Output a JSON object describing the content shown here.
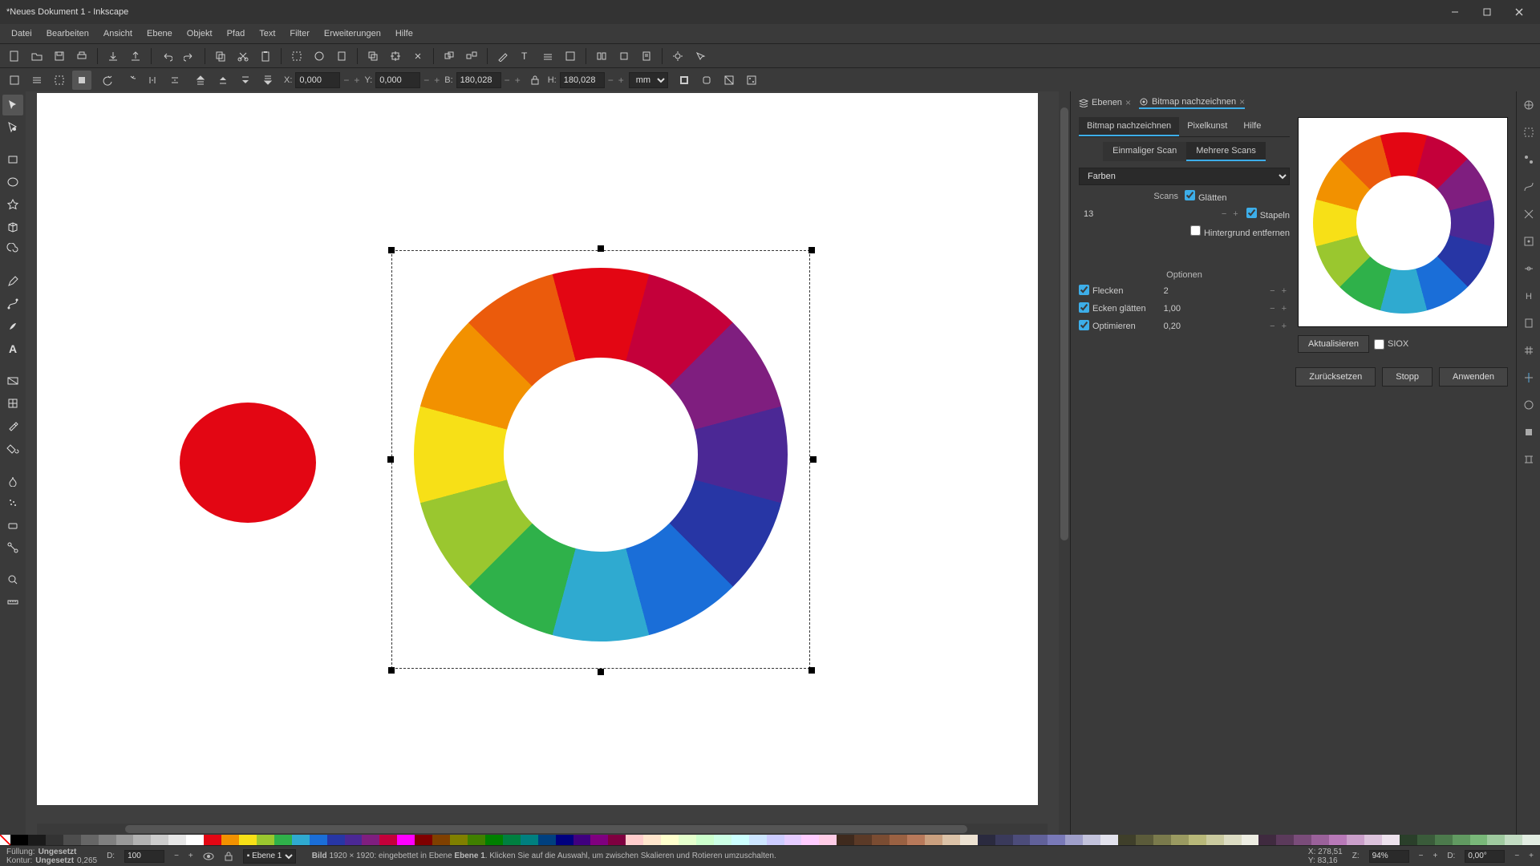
{
  "titlebar": {
    "title": "*Neues Dokument 1 - Inkscape"
  },
  "menu": {
    "items": [
      "Datei",
      "Bearbeiten",
      "Ansicht",
      "Ebene",
      "Objekt",
      "Pfad",
      "Text",
      "Filter",
      "Erweiterungen",
      "Hilfe"
    ]
  },
  "toolcontrol": {
    "x_label": "X:",
    "x": "0,000",
    "y_label": "Y:",
    "y": "0,000",
    "w_label": "B:",
    "w": "180,028",
    "h_label": "H:",
    "h": "180,028",
    "unit": "mm"
  },
  "dock": {
    "tab_layers": "Ebenen",
    "tab_trace": "Bitmap nachzeichnen",
    "trace_tabs": {
      "trace": "Bitmap nachzeichnen",
      "pixel": "Pixelkunst",
      "help": "Hilfe"
    },
    "sub_tabs": {
      "single": "Einmaliger Scan",
      "multi": "Mehrere Scans"
    },
    "mode": "Farben",
    "scans_label": "Scans",
    "scans": "13",
    "smooth": "Glätten",
    "stack": "Stapeln",
    "removebg": "Hintergrund entfernen",
    "options_header": "Optionen",
    "speckles": "Flecken",
    "speckles_val": "2",
    "corners": "Ecken glätten",
    "corners_val": "1,00",
    "optimize": "Optimieren",
    "optimize_val": "0,20",
    "update": "Aktualisieren",
    "siox": "SIOX",
    "reset": "Zurücksetzen",
    "stop": "Stopp",
    "apply": "Anwenden"
  },
  "status": {
    "fill_label": "Füllung:",
    "fill_val": "Ungesetzt",
    "stroke_label": "Kontur:",
    "stroke_val": "Ungesetzt",
    "stroke_w": "0,265",
    "opacity_label": "D:",
    "opacity": "100",
    "layer": "Ebene 1",
    "obj_type": "Bild",
    "obj_dims": "1920 × 1920:",
    "obj_msg": "eingebettet in Ebene",
    "obj_layer_bold": "Ebene 1",
    "obj_hint": ". Klicken Sie auf die Auswahl, um zwischen Skalieren und Rotieren umzuschalten.",
    "cx_label": "X:",
    "cx": "278,51",
    "cy_label": "Y:",
    "cy": "83,16",
    "zoom_label": "Z:",
    "zoom": "94%",
    "rot_label": "D:",
    "rot": "0,00°"
  },
  "palette_colors": [
    "#000000",
    "#1a1a1a",
    "#333333",
    "#4d4d4d",
    "#666666",
    "#808080",
    "#999999",
    "#b3b3b3",
    "#cccccc",
    "#e6e6e6",
    "#ffffff",
    "#e30613",
    "#f29100",
    "#f7e017",
    "#9ac72f",
    "#2fb14a",
    "#2faad0",
    "#1a6ed8",
    "#2736a5",
    "#4b2895",
    "#7f1e7f",
    "#c4003a",
    "#ff00ff",
    "#800000",
    "#804000",
    "#808000",
    "#408000",
    "#008000",
    "#008040",
    "#008080",
    "#004080",
    "#000080",
    "#400080",
    "#800080",
    "#800040",
    "#ffcccc",
    "#ffe5cc",
    "#ffffcc",
    "#e5ffcc",
    "#ccffcc",
    "#ccffe5",
    "#ccffff",
    "#cce5ff",
    "#ccccff",
    "#e5ccff",
    "#ffccff",
    "#ffcce6",
    "#3f2a1d",
    "#5b3a27",
    "#7a4c32",
    "#9a6142",
    "#b8795a",
    "#caa07f",
    "#dcc3a8",
    "#ede2d2",
    "#2a2a3f",
    "#3a3a5b",
    "#4c4c7a",
    "#61619a",
    "#7979b8",
    "#9f9fca",
    "#c3c3dc",
    "#e2e2ed",
    "#3f3f2a",
    "#5b5b3a",
    "#7a7a4c",
    "#9a9a61",
    "#b8b879",
    "#caca9f",
    "#dcdcc3",
    "#edede2",
    "#3f2a3f",
    "#5b3a5b",
    "#7a4c7a",
    "#9a619a",
    "#b879b8",
    "#ca9fca",
    "#dcc3dc",
    "#ede2ed",
    "#2a3f2a",
    "#3a5b3a",
    "#4c7a4c",
    "#619a61",
    "#79b879",
    "#9fca9f",
    "#c3dcc3",
    "#e2ede2"
  ]
}
